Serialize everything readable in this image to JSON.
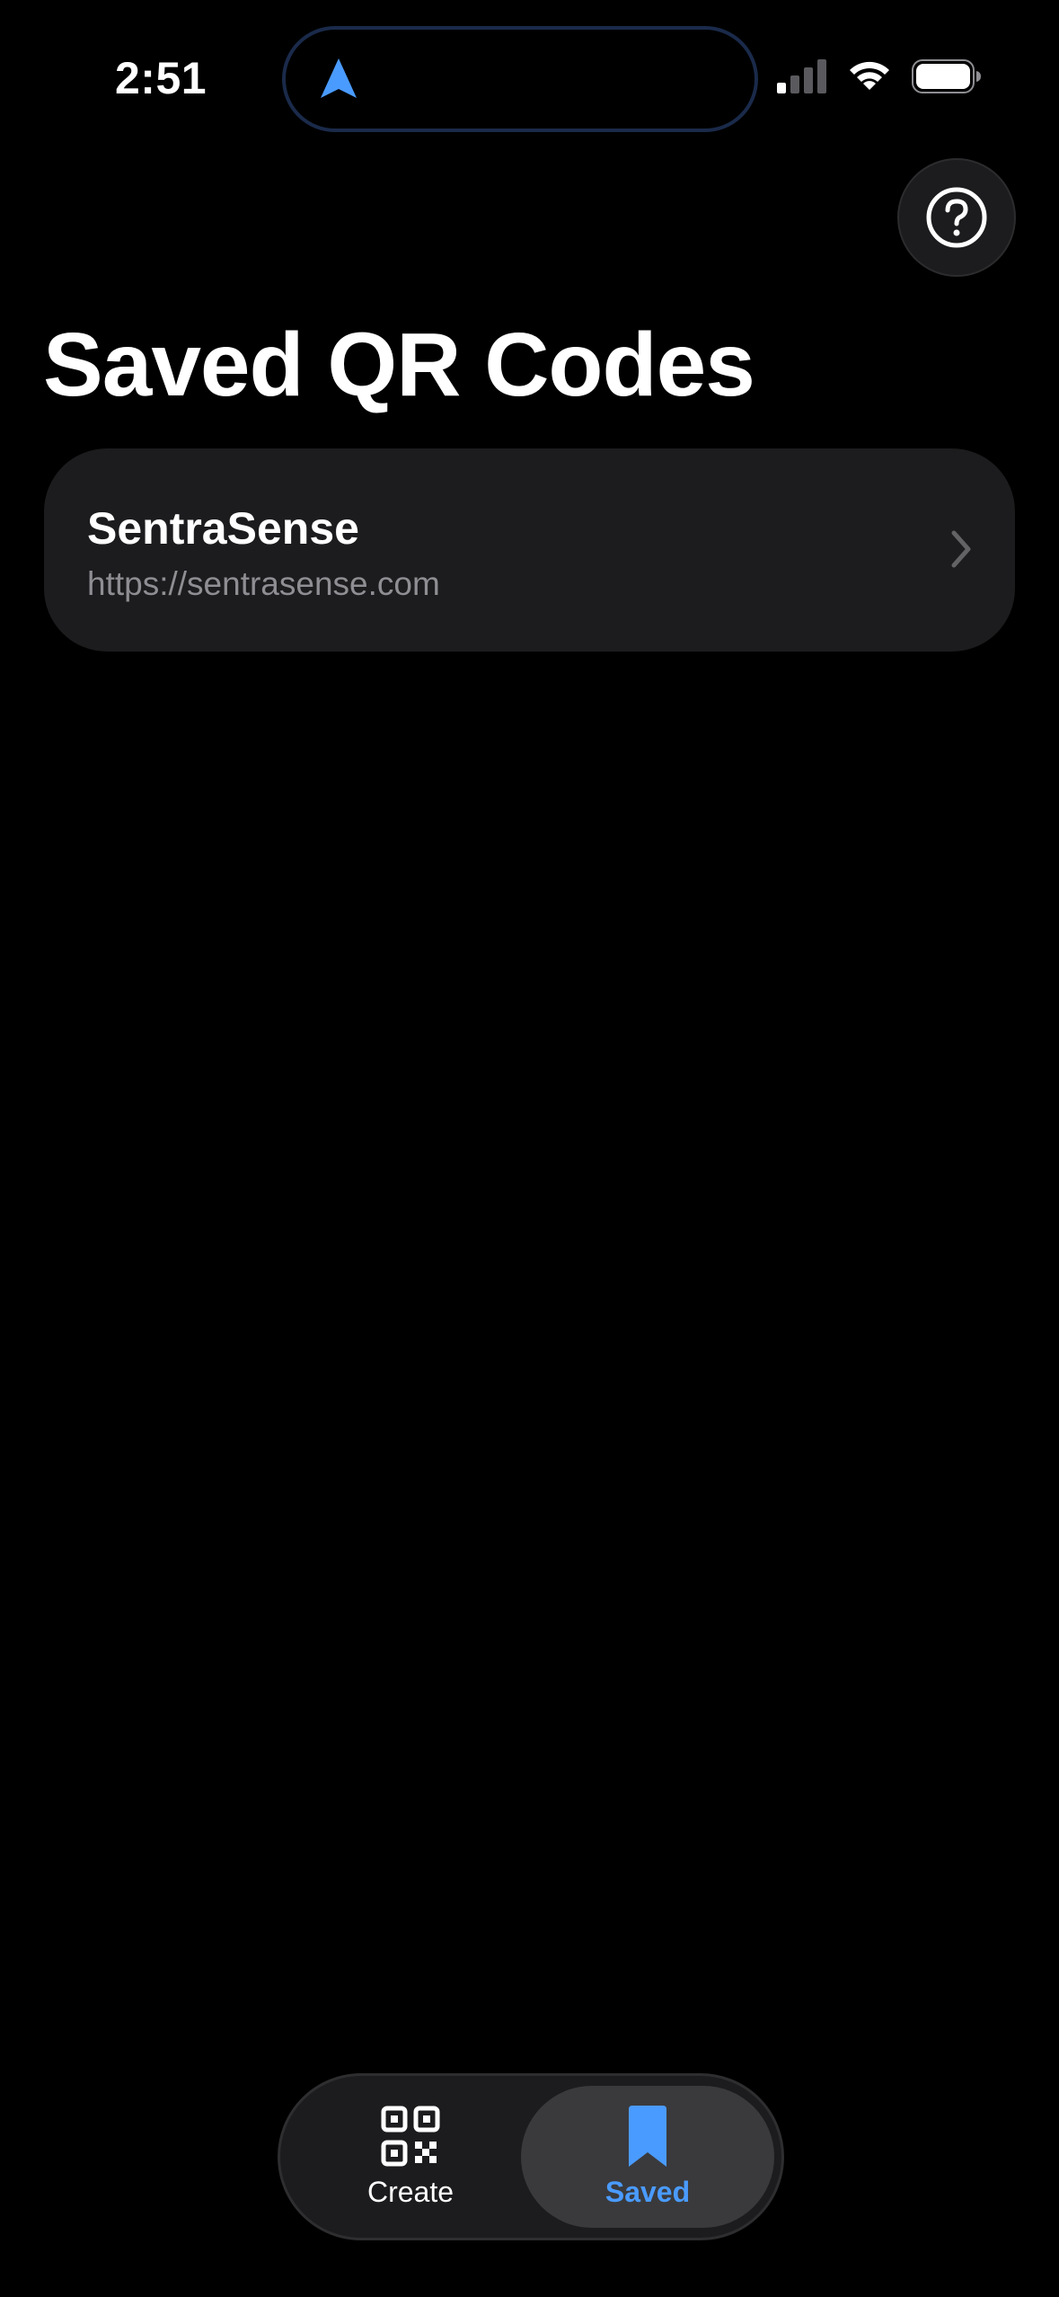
{
  "status_bar": {
    "time": "2:51",
    "icons": [
      "location-arrow-icon",
      "cellular-signal-icon",
      "wifi-icon",
      "battery-icon"
    ]
  },
  "colors": {
    "accent": "#4a9bff",
    "card_bg": "#1c1c1e",
    "secondary_text": "#8e8e93",
    "selected_tab_bg": "#3a3a3c"
  },
  "header": {
    "help_icon": "question-circle-icon",
    "title": "Saved QR Codes"
  },
  "saved_items": [
    {
      "title": "SentraSense",
      "url": "https://sentrasense.com",
      "icon": "chevron-right-icon"
    }
  ],
  "tab_bar": {
    "tabs": [
      {
        "label": "Create",
        "icon": "qr-code-icon",
        "selected": false
      },
      {
        "label": "Saved",
        "icon": "bookmark-icon",
        "selected": true
      }
    ]
  }
}
